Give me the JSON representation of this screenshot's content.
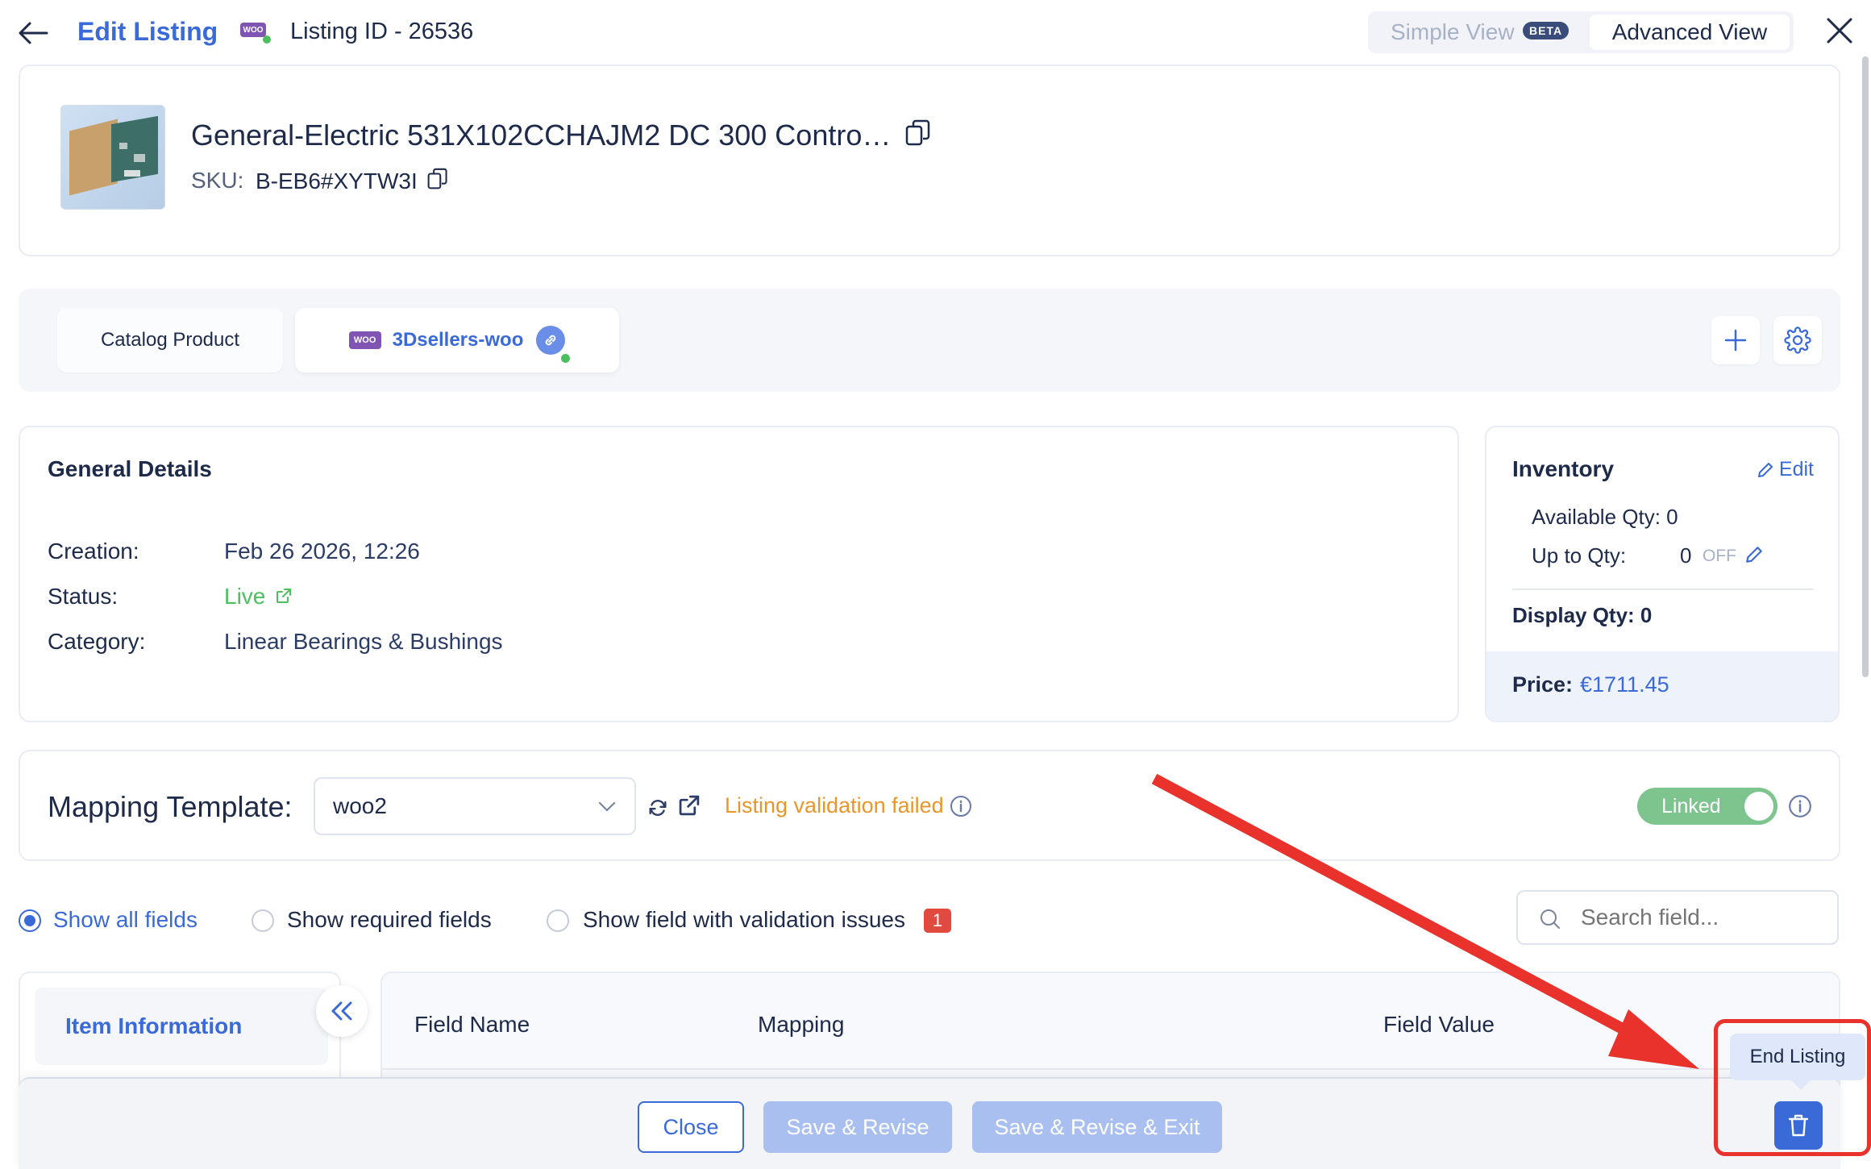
{
  "header": {
    "title": "Edit Listing",
    "channel_badge": "WOO",
    "listing_id": "Listing ID - 26536",
    "view_simple": "Simple View",
    "beta": "BETA",
    "view_advanced": "Advanced View"
  },
  "product": {
    "title": "General-Electric 531X102CCHAJM2 DC 300 Contro…",
    "sku_label": "SKU:",
    "sku_value": "B-EB6#XYTW3I"
  },
  "channels": {
    "tabs": [
      {
        "label": "Catalog Product"
      },
      {
        "label": "3Dsellers-woo",
        "badge": "WOO"
      }
    ]
  },
  "general": {
    "title": "General Details",
    "rows": [
      {
        "label": "Creation:",
        "value": "Feb 26 2026, 12:26"
      },
      {
        "label": "Status:",
        "value": "Live"
      },
      {
        "label": "Category:",
        "value": "Linear Bearings & Bushings"
      }
    ],
    "status_color": "#4cbf5e"
  },
  "inventory": {
    "title": "Inventory",
    "edit_label": "Edit",
    "available": "Available Qty: 0",
    "up_to_label": "Up to Qty:",
    "up_to_value": "0",
    "up_to_state": "OFF",
    "display": "Display Qty: 0",
    "price_label": "Price:",
    "price_value": "€1711.45"
  },
  "mapping": {
    "label": "Mapping Template:",
    "selected": "woo2",
    "validation": "Listing validation failed",
    "linked_label": "Linked",
    "validation_color": "#e8962b"
  },
  "filters": {
    "options": [
      {
        "label": "Show all fields",
        "selected": true
      },
      {
        "label": "Show required fields",
        "selected": false
      },
      {
        "label": "Show field with validation issues",
        "selected": false,
        "badge": "1"
      }
    ],
    "search_placeholder": "Search field..."
  },
  "sidebar": {
    "items": [
      {
        "label": "Item Information"
      }
    ]
  },
  "table": {
    "columns": [
      "Field Name",
      "Mapping",
      "Field Value"
    ]
  },
  "footer": {
    "close": "Close",
    "save_revise": "Save & Revise",
    "save_revise_exit": "Save & Revise & Exit",
    "end_listing_tooltip": "End Listing"
  },
  "colors": {
    "accent": "#3a6ad8",
    "annotation": "#e8322b"
  }
}
